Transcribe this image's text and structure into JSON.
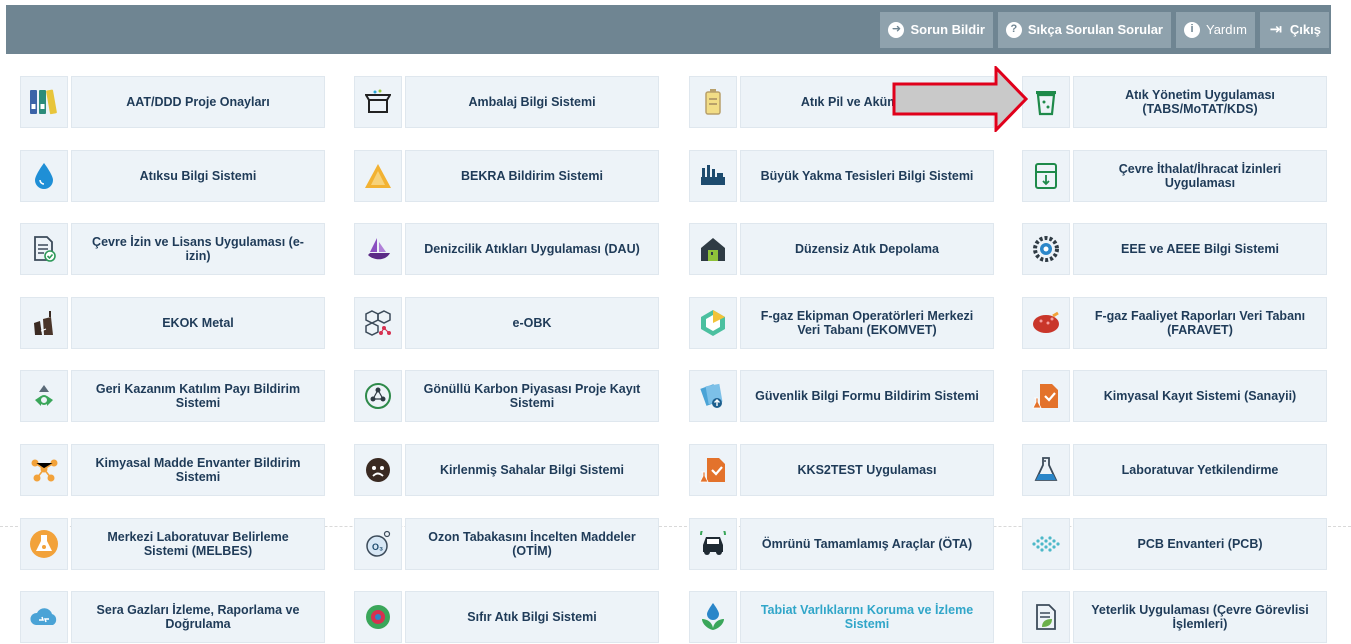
{
  "header": {
    "buttons": [
      {
        "label": "Sorun Bildir",
        "icon": "arrow-circle-icon"
      },
      {
        "label": "Sıkça Sorulan Sorular",
        "icon": "question-icon"
      },
      {
        "label": "Yardım",
        "icon": "info-icon"
      },
      {
        "label": "Çıkış",
        "icon": "logout-icon"
      }
    ]
  },
  "apps": [
    {
      "label": "AAT/DDD Proje Onayları",
      "icon": "binders-icon"
    },
    {
      "label": "Ambalaj Bilgi Sistemi",
      "icon": "box-icon"
    },
    {
      "label": "Atık Pil ve Akümülatör",
      "icon": "battery-icon"
    },
    {
      "label": "Atık Yönetim Uygulaması (TABS/MoTAT/KDS)",
      "icon": "trash-bin-icon"
    },
    {
      "label": "Atıksu Bilgi Sistemi",
      "icon": "water-drop-icon"
    },
    {
      "label": "BEKRA Bildirim Sistemi",
      "icon": "triangle-icon"
    },
    {
      "label": "Büyük Yakma Tesisleri Bilgi Sistemi",
      "icon": "factory-icon"
    },
    {
      "label": "Çevre İthalat/İhracat İzinleri Uygulaması",
      "icon": "import-export-icon"
    },
    {
      "label": "Çevre İzin ve Lisans Uygulaması (e-izin)",
      "icon": "document-check-icon"
    },
    {
      "label": "Denizcilik Atıkları Uygulaması (DAU)",
      "icon": "ship-icon"
    },
    {
      "label": "Düzensiz Atık Depolama",
      "icon": "house-icon"
    },
    {
      "label": "EEE ve AEEE Bilgi Sistemi",
      "icon": "gear-icon"
    },
    {
      "label": "EKOK Metal",
      "icon": "metal-icon"
    },
    {
      "label": "e-OBK",
      "icon": "molecule-icon"
    },
    {
      "label": "F-gaz Ekipman Operatörleri Merkezi Veri Tabanı (EKOMVET)",
      "icon": "hexagon-icon"
    },
    {
      "label": "F-gaz Faaliyet Raporları Veri Tabanı (FARAVET)",
      "icon": "meat-icon"
    },
    {
      "label": "Geri Kazanım Katılım Payı Bildirim Sistemi",
      "icon": "recycle-icon"
    },
    {
      "label": "Gönüllü Karbon Piyasası Proje Kayıt Sistemi",
      "icon": "network-circle-icon"
    },
    {
      "label": "Güvenlik Bilgi Formu Bildirim Sistemi",
      "icon": "upload-document-icon"
    },
    {
      "label": "Kimyasal Kayıt Sistemi (Sanayii)",
      "icon": "chemical-document-icon"
    },
    {
      "label": "Kimyasal Madde Envanter Bildirim Sistemi",
      "icon": "molecule-orange-icon"
    },
    {
      "label": "Kirlenmiş Sahalar Bilgi Sistemi",
      "icon": "sad-face-icon"
    },
    {
      "label": "KKS2TEST Uygulaması",
      "icon": "chemical-document-icon"
    },
    {
      "label": "Laboratuvar Yetkilendirme",
      "icon": "flask-icon"
    },
    {
      "label": "Merkezi Laboratuvar Belirleme Sistemi (MELBES)",
      "icon": "lab-flask-icon"
    },
    {
      "label": "Ozon Tabakasını İncelten Maddeler (OTİM)",
      "icon": "ozone-icon"
    },
    {
      "label": "Ömrünü Tamamlamış Araçlar (ÖTA)",
      "icon": "car-icon"
    },
    {
      "label": "PCB Envanteri (PCB)",
      "icon": "dots-icon"
    },
    {
      "label": "Sera Gazları İzleme, Raporlama ve Doğrulama",
      "icon": "cloud-icon"
    },
    {
      "label": "Sıfır Atık Bilgi Sistemi",
      "icon": "zero-waste-icon"
    },
    {
      "label": "Tabiat Varlıklarını Koruma ve İzleme Sistemi",
      "icon": "plant-drop-icon"
    },
    {
      "label": "Yeterlik Uygulaması (Çevre Görevlisi İşlemleri)",
      "icon": "leaf-document-icon"
    }
  ],
  "colors": {
    "topbar": "#6f8592",
    "tile_bg": "#edf3f8",
    "tile_text": "#1f3b58",
    "highlight_arrow": "#e0001b"
  }
}
